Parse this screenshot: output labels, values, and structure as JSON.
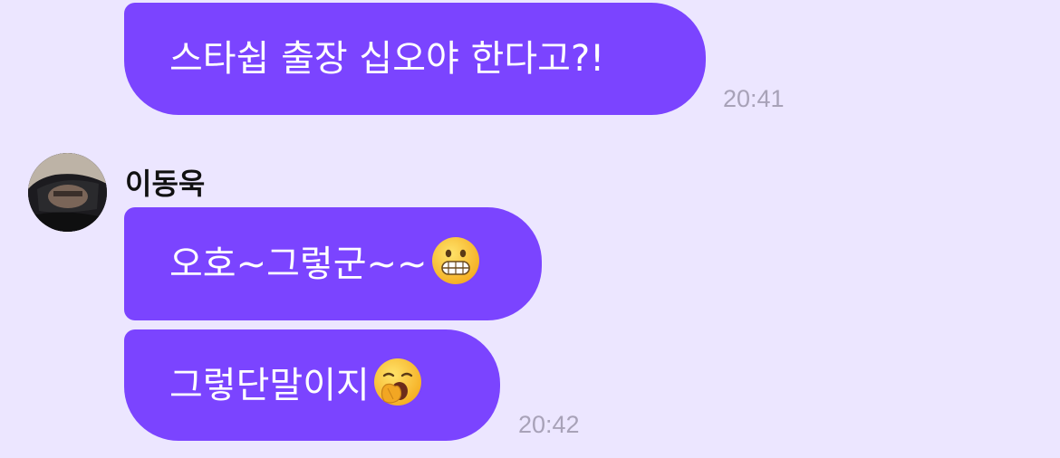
{
  "chat": {
    "messages": [
      {
        "text": "스타쉽 출장 십오야 한다고?!",
        "time": "20:41"
      },
      {
        "sender": "이동욱",
        "text": "오호~그렇군~~",
        "emoji": "grimacing-face"
      },
      {
        "text": "그렇단말이지",
        "emoji": "yawning-face",
        "time": "20:42"
      }
    ]
  },
  "colors": {
    "background": "#ECE6FF",
    "bubble": "#7B44FF",
    "bubble_text": "#FFFFFF",
    "timestamp": "#A8A2B8"
  }
}
